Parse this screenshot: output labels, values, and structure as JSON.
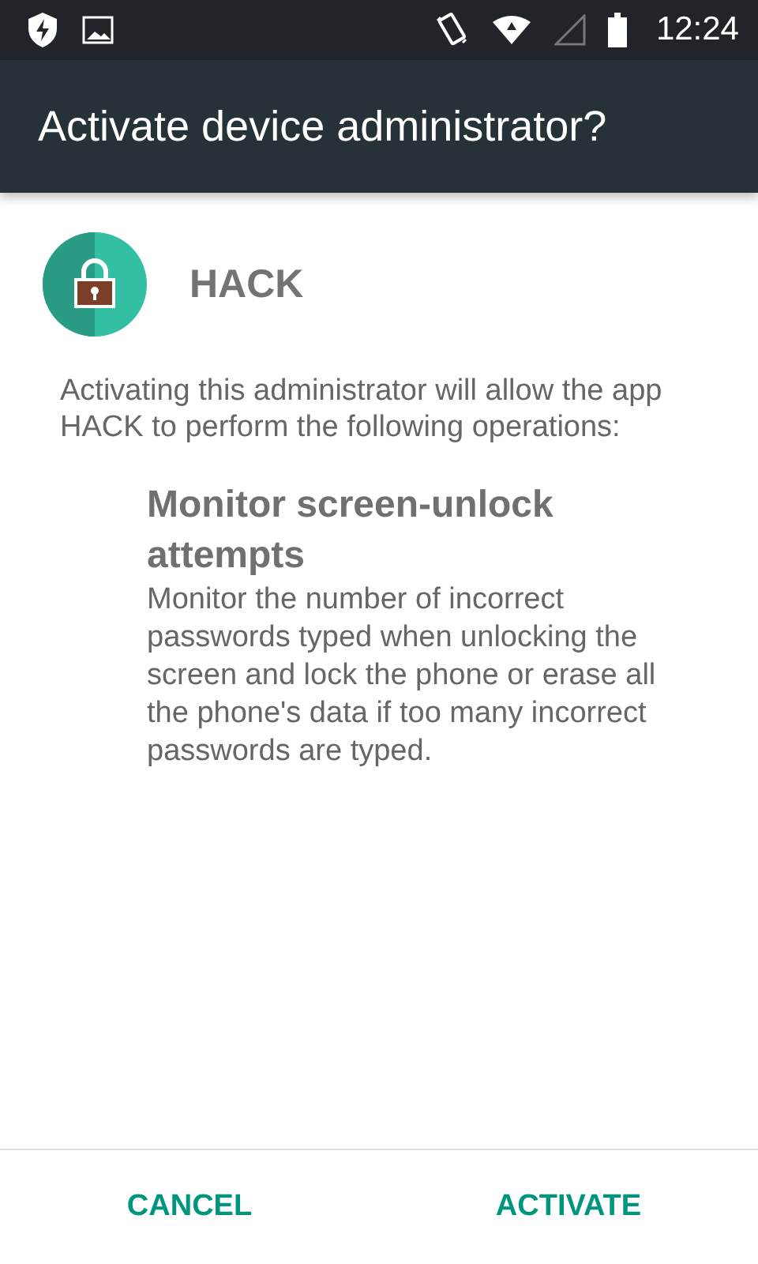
{
  "status_bar": {
    "time": "12:24"
  },
  "dialog": {
    "title": "Activate device administrator?",
    "app": {
      "name": "HACK"
    },
    "description": "Activating this administrator will allow the app HACK to perform the following operations:",
    "policies": [
      {
        "title": "Monitor screen-unlock attempts",
        "description": "Monitor the number of incorrect passwords typed when unlocking the screen and lock the phone or erase all the phone's data if too many incorrect passwords are typed."
      }
    ],
    "buttons": [
      "CANCEL",
      "ACTIVATE"
    ]
  }
}
